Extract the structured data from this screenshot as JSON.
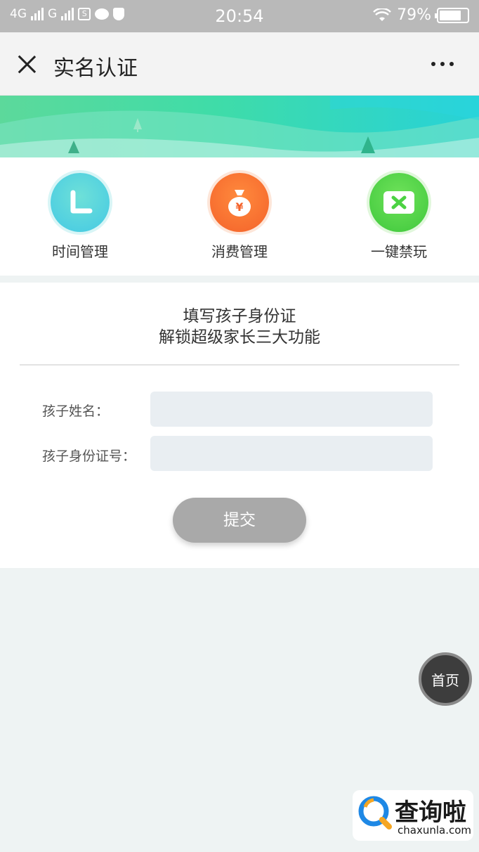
{
  "status_bar": {
    "network1": "4G",
    "network2": "G",
    "time": "20:54",
    "battery_text": "79%",
    "battery_level": 0.79
  },
  "header": {
    "title": "实名认证"
  },
  "features": [
    {
      "label": "时间管理",
      "icon": "clock-icon",
      "color": "#4ccfe2"
    },
    {
      "label": "消费管理",
      "icon": "money-bag-icon",
      "color": "#f76a2e"
    },
    {
      "label": "一键禁玩",
      "icon": "ban-icon",
      "color": "#4cd243"
    }
  ],
  "form": {
    "headline_line1": "填写孩子身份证",
    "headline_line2": "解锁超级家长三大功能",
    "name_label": "孩子姓名：",
    "name_value": "",
    "id_label": "孩子身份证号：",
    "id_value": "",
    "submit_label": "提交"
  },
  "home_button": {
    "label": "首页"
  },
  "watermark": {
    "brand": "查询啦",
    "url": "chaxunla.com"
  },
  "colors": {
    "banner_start": "#5cd99b",
    "banner_end": "#27d2d8",
    "submit_disabled": "#a9a9a9",
    "input_bg": "#e9eef2"
  }
}
